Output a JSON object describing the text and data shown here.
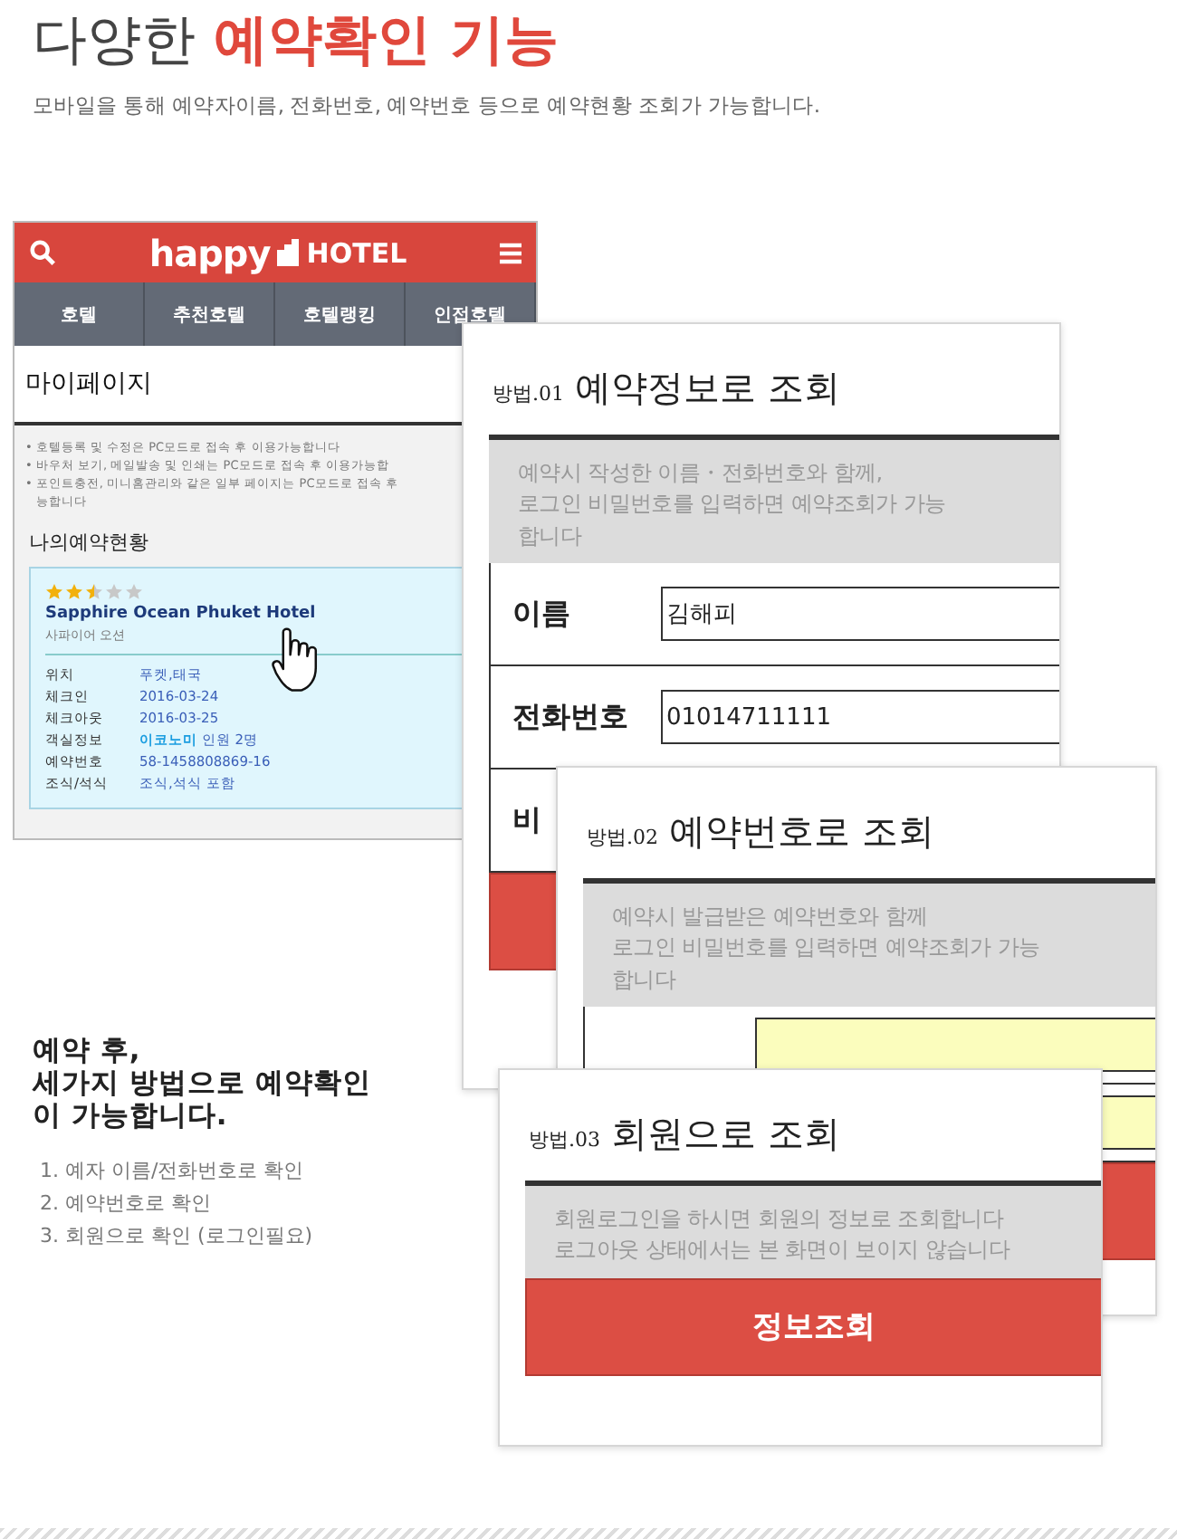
{
  "header": {
    "title_lead": "다양한",
    "title_highlight": "예약확인 기능",
    "subtitle": "모바일을 통해 예약자이름, 전화번호, 예약번호 등으로 예약현황 조회가 가능합니다."
  },
  "mobile_screen": {
    "brand_word": "happy",
    "brand_name": "HOTEL",
    "tabs": [
      {
        "label": "호텔"
      },
      {
        "label": "추천호텔"
      },
      {
        "label": "호텔랭킹"
      },
      {
        "label": "인접호텔"
      }
    ],
    "page_title": "마이페이지",
    "notes": [
      "• 호텔등록 및 수정은 PC모드로 접속 후 이용가능합니다",
      "• 바우처 보기, 메일발송 및 인쇄는 PC모드로 접속 후 이용가능합",
      "• 포인트충전, 미니홈관리와 같은 일부 페이지는 PC모드로 접속 후"
    ],
    "notes_tail": "능합니다",
    "section_title": "나의예약현황",
    "booking": {
      "stars": 2.5,
      "hotel_name": "Sapphire Ocean Phuket Hotel",
      "hotel_name_local": "사파이어 오션",
      "details": [
        {
          "label": "위치",
          "value": "푸켓,태국"
        },
        {
          "label": "체크인",
          "value": "2016-03-24"
        },
        {
          "label": "체크아웃",
          "value": "2016-03-25"
        },
        {
          "label": "객실정보",
          "value": "**이코노미** 인원 2명"
        },
        {
          "label": "예약번호",
          "value": "58-1458808869-16"
        },
        {
          "label": "조식/석식",
          "value": "조식,석식 포함"
        }
      ]
    }
  },
  "summary": {
    "heading": "예약 후,\n세가지 방법으로 예약확인\n이 가능합니다.",
    "items": [
      "1. 예자 이름/전화번호로 확인",
      "2. 예약번호로 확인",
      "3. 회원으로 확인 (로그인필요)"
    ]
  },
  "panels": [
    {
      "method": "방법.01",
      "title": "예약정보로 조회",
      "description": "예약시 작성한 이름・전화번호와 함께,\n로그인 비밀번호를 입력하면 예약조회가 가능\n합니다",
      "fields": [
        {
          "label": "이름",
          "value": "김해피",
          "kind": "text"
        },
        {
          "label": "전화번호",
          "value": "01014711111",
          "kind": "text"
        },
        {
          "label": "비",
          "kind": "text"
        }
      ]
    },
    {
      "method": "방법.02",
      "title": "예약번호로 조회",
      "description": "예약시 발급받은 예약번호와 함께\n로그인 비밀번호를 입력하면 예약조회가 가능\n합니다",
      "fields": [
        {
          "kind": "highlight"
        },
        {
          "kind": "highlight"
        }
      ]
    },
    {
      "method": "방법.03",
      "title": "회원으로 조회",
      "description": "회원로그인을 하시면 회원의 정보로 조회합니다\n로그아웃 상태에서는 본 화면이 보이지 않습니다",
      "button_label": "정보조회"
    }
  ]
}
